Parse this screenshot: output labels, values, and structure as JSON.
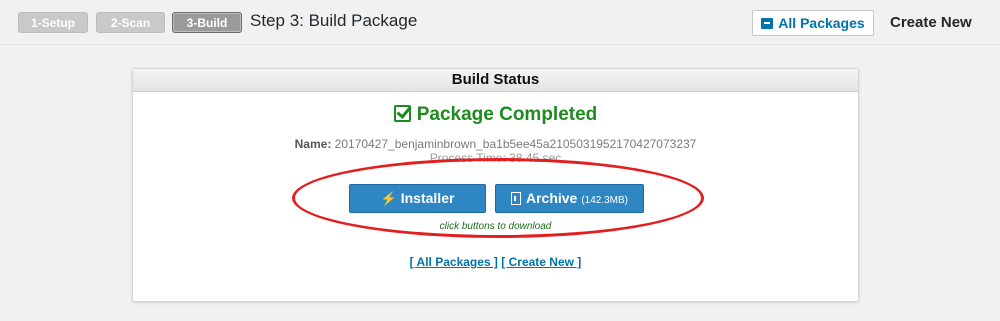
{
  "steps": [
    {
      "label": "1-Setup"
    },
    {
      "label": "2-Scan"
    },
    {
      "label": "3-Build"
    }
  ],
  "header": {
    "title": "Step 3: Build Package",
    "all_packages": "All Packages",
    "create_new": "Create New"
  },
  "panel": {
    "title": "Build Status",
    "status": "Package Completed",
    "name_label": "Name:",
    "name_value": "20170427_benjaminbrown_ba1b5ee45a2105031952170427073237",
    "process_time": "Process Time: 38.45 sec",
    "installer_label": "Installer",
    "archive_label": "Archive",
    "archive_size": "(142.3MB)",
    "hint": "click buttons to download",
    "link_all": "[ All Packages ]",
    "link_create": "[ Create New ]"
  },
  "colors": {
    "accent": "#0073aa",
    "success": "#1f8a1f",
    "button": "#2e86c2",
    "highlight": "#e21e1e"
  }
}
